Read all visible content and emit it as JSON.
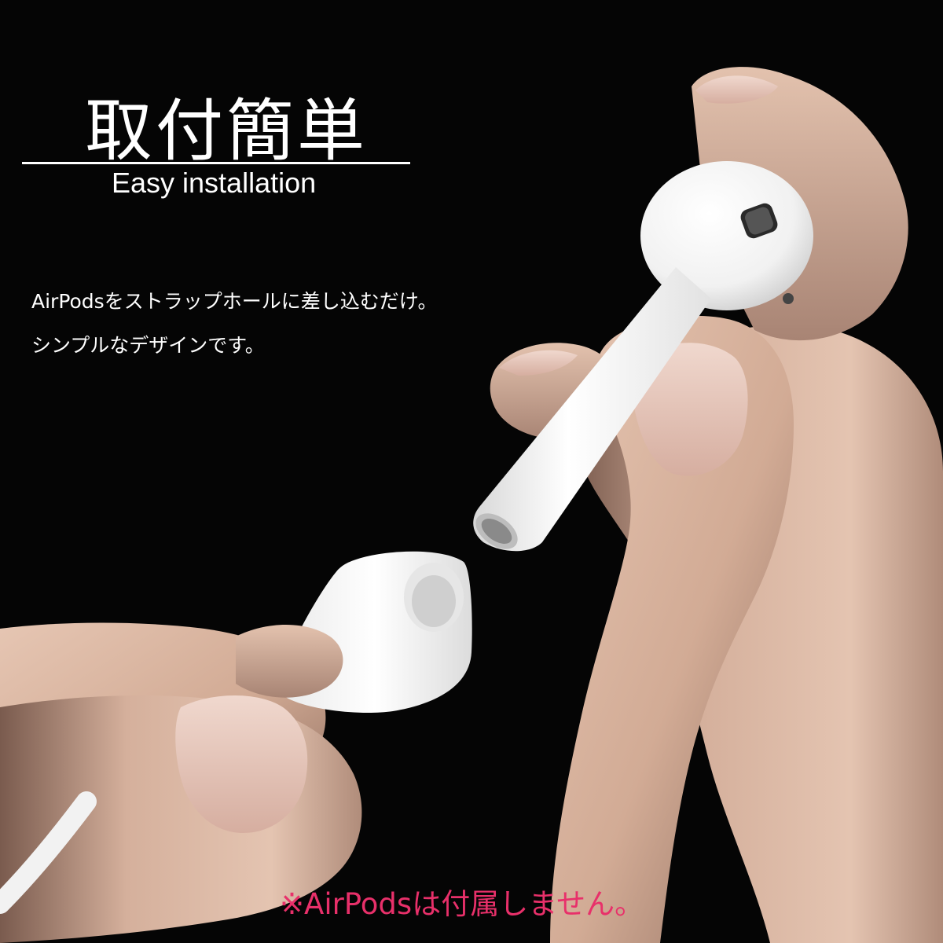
{
  "headline": "取付簡単",
  "subheadline": "Easy installation",
  "description": [
    "AirPodsをストラップホールに差し込むだけ。",
    "シンプルなデザインです。"
  ],
  "note": "※AirPodsは付属しません。",
  "colors": {
    "background": "#050505",
    "text": "#ffffff",
    "note": "#e8306a",
    "skin": "#d9b7a3",
    "earbud": "#f7f7f7"
  }
}
